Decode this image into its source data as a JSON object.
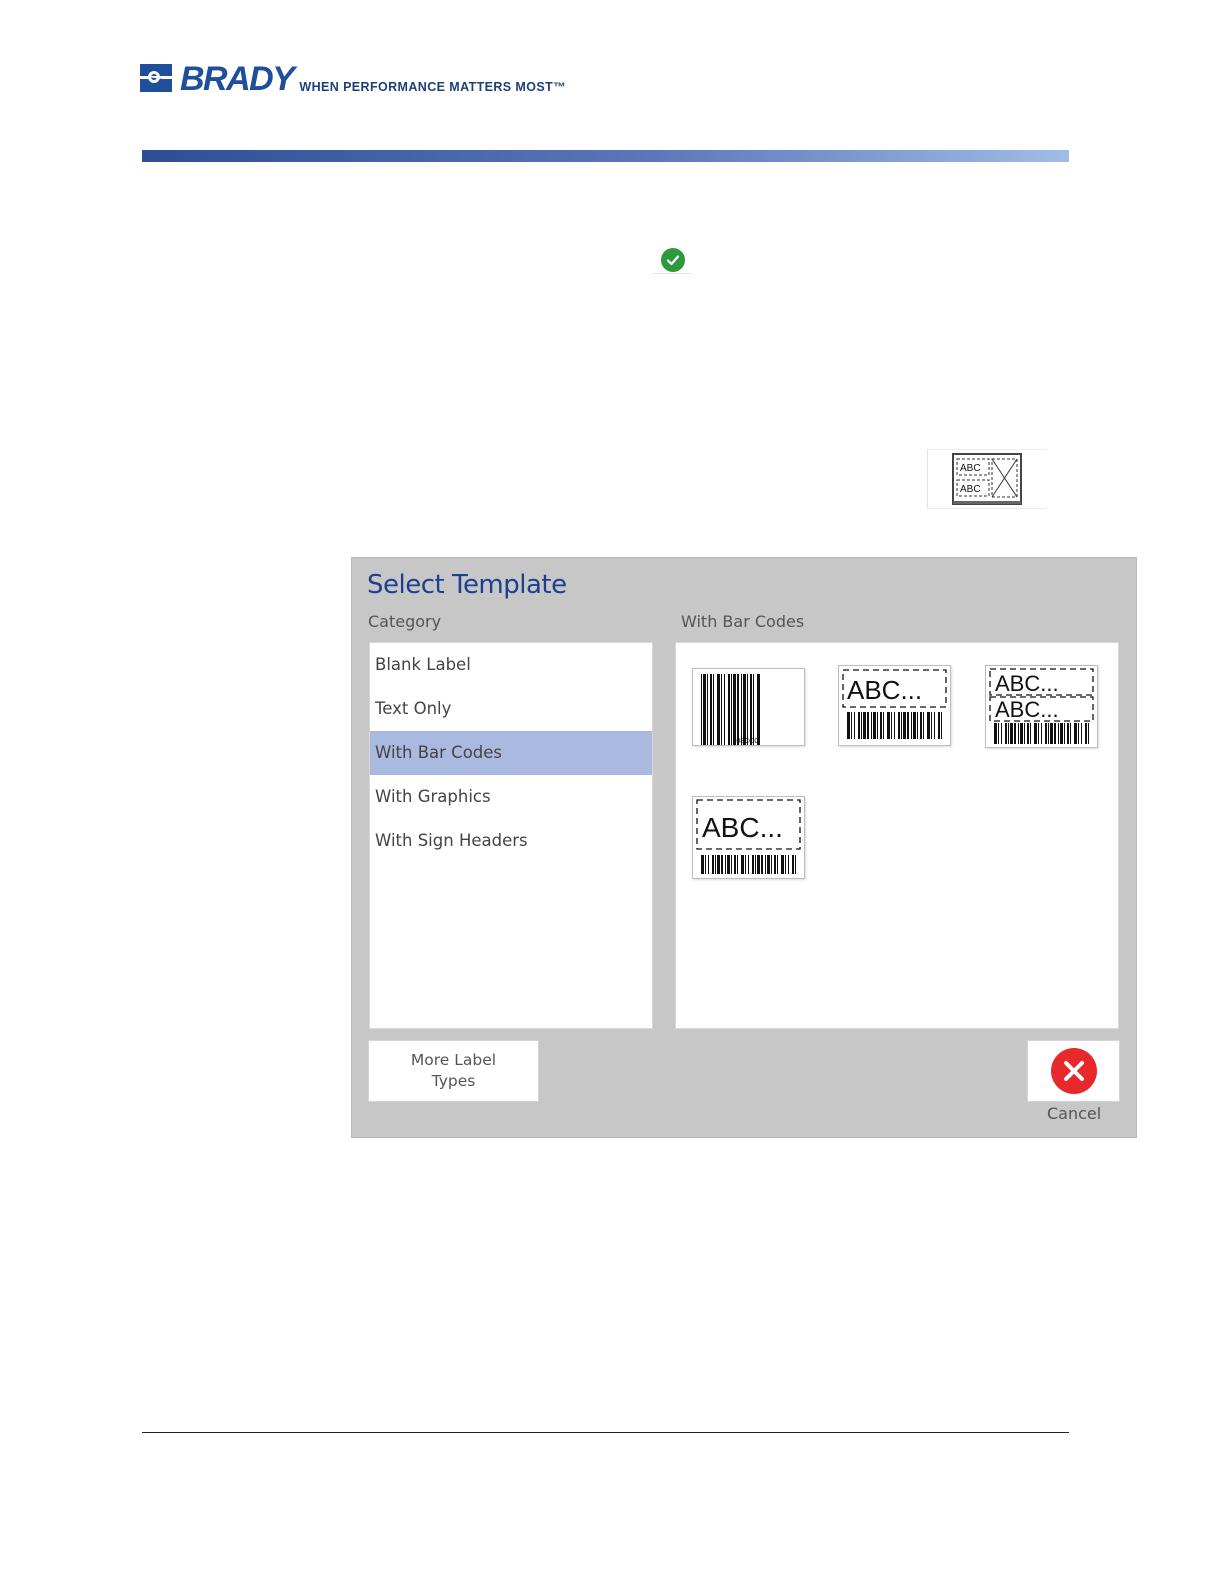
{
  "brand": {
    "name": "BRADY",
    "tagline": "WHEN PERFORMANCE MATTERS MOST™",
    "color": "#1f4f9a"
  },
  "icons": {
    "check": "check-circle-icon",
    "template": "template-icon",
    "cancel": "cancel-icon"
  },
  "dialog": {
    "title": "Select Template",
    "category_label": "Category",
    "right_label": "With Bar Codes",
    "categories": [
      {
        "label": "Blank Label",
        "selected": false
      },
      {
        "label": "Text Only",
        "selected": false
      },
      {
        "label": "With Bar Codes",
        "selected": true
      },
      {
        "label": "With Graphics",
        "selected": false
      },
      {
        "label": "With Sign Headers",
        "selected": false
      }
    ],
    "templates": [
      {
        "name": "barcode-only",
        "barcode_text": "08CCO"
      },
      {
        "name": "text-and-barcode",
        "text": "ABC..."
      },
      {
        "name": "two-text-and-barcode",
        "text": "ABC...",
        "text2": "ABC..."
      },
      {
        "name": "large-text-and-barcode",
        "text": "ABC..."
      }
    ],
    "template_icon_text": "ABC",
    "more_button": "More Label Types",
    "cancel_label": "Cancel",
    "selected_color": "#aab9e0",
    "title_color": "#1d3f8e",
    "cancel_color": "#e8292b",
    "check_color": "#2c9a3c"
  }
}
